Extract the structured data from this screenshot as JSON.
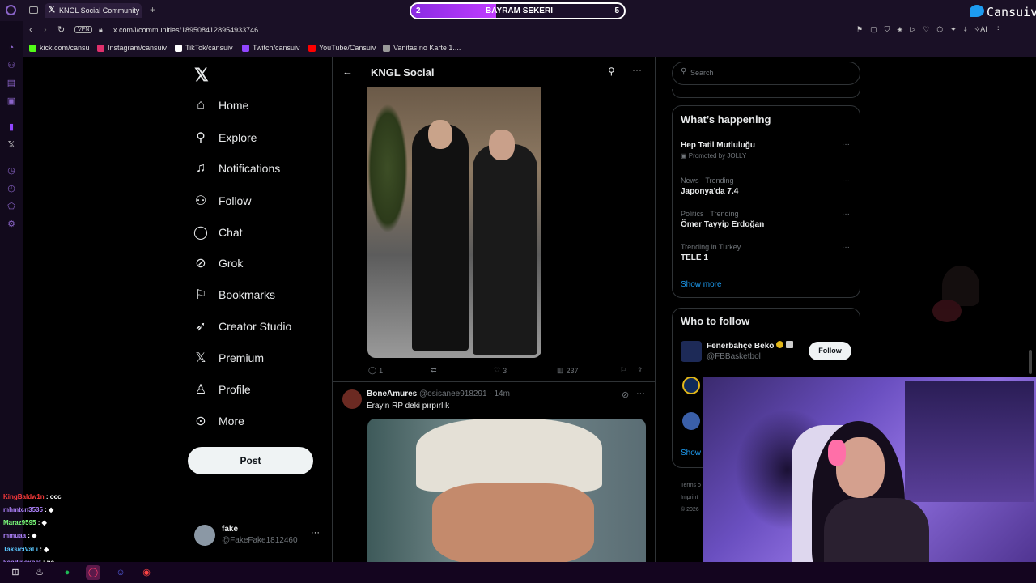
{
  "browser": {
    "tab_title": "KNGL Social Community /",
    "url": "x.com/i/communities/1895084128954933746",
    "vpn_badge": "VPN",
    "ai_label": "AI",
    "bookmarks": [
      "kick.com/cansu",
      "Instagram/cansuiv",
      "TikTok/cansuiv",
      "Twitch/cansuiv",
      "YouTube/Cansuiv",
      "Vanitas no Karte 1...."
    ]
  },
  "stream_overlay": {
    "bar_left": "2",
    "bar_label": "BAYRAM SEKERI",
    "bar_right": "5",
    "bar_progress": 0.4,
    "brand": "Cansuiv"
  },
  "nav": {
    "items": [
      {
        "label": "Home",
        "icon": "home-icon"
      },
      {
        "label": "Explore",
        "icon": "search-icon"
      },
      {
        "label": "Notifications",
        "icon": "bell-icon"
      },
      {
        "label": "Follow",
        "icon": "add-user-icon"
      },
      {
        "label": "Chat",
        "icon": "chat-icon"
      },
      {
        "label": "Grok",
        "icon": "grok-icon"
      },
      {
        "label": "Bookmarks",
        "icon": "bookmark-icon"
      },
      {
        "label": "Creator Studio",
        "icon": "rocket-icon"
      },
      {
        "label": "Premium",
        "icon": "x-logo-icon"
      },
      {
        "label": "Profile",
        "icon": "person-icon"
      },
      {
        "label": "More",
        "icon": "more-circle-icon"
      }
    ],
    "post_button": "Post",
    "account": {
      "name": "fake",
      "handle": "@FakeFake1812460"
    }
  },
  "main": {
    "header_title": "KNGL Social",
    "post1_actions": {
      "replies": "1",
      "reposts": "",
      "likes": "3",
      "views": "237"
    },
    "post2": {
      "author": "BoneAmures",
      "handle": "@osisanee918291",
      "time": "14m",
      "text": "Erayin RP deki pırpırlık"
    }
  },
  "sidebar": {
    "search_placeholder": "Search",
    "happening_title": "What’s happening",
    "trends": [
      {
        "meta": "",
        "title": "Hep Tatil Mutluluğu",
        "promo": "Promoted by JOLLY"
      },
      {
        "meta": "News · Trending",
        "title": "Japonya'da 7.4"
      },
      {
        "meta": "Politics · Trending",
        "title": "Ömer Tayyip Erdoğan"
      },
      {
        "meta": "Trending in Turkey",
        "title": "TELE 1"
      }
    ],
    "show_more": "Show more",
    "who_to_follow_title": "Who to follow",
    "follow_suggestion": {
      "name": "Fenerbahçe Beko",
      "handle": "@FBBasketbol",
      "button": "Follow"
    },
    "show_partial": "Show",
    "footer": [
      "Terms o",
      "Imprint",
      "© 2026"
    ]
  },
  "chat": [
    {
      "user": "KingBaldw1n",
      "msg": "occ",
      "color": "#ff3b3b"
    },
    {
      "user": "mhmtcn3535",
      "msg": "",
      "color": "#b084ff"
    },
    {
      "user": "Maraz9595",
      "msg": "",
      "color": "#7cff7c"
    },
    {
      "user": "mmuaa",
      "msg": "",
      "color": "#b084ff"
    },
    {
      "user": "TaksiciVaLi",
      "msg": "",
      "color": "#5bc8ff"
    },
    {
      "user": "kendinexbet",
      "msg": "ne",
      "color": "#b084ff"
    }
  ]
}
